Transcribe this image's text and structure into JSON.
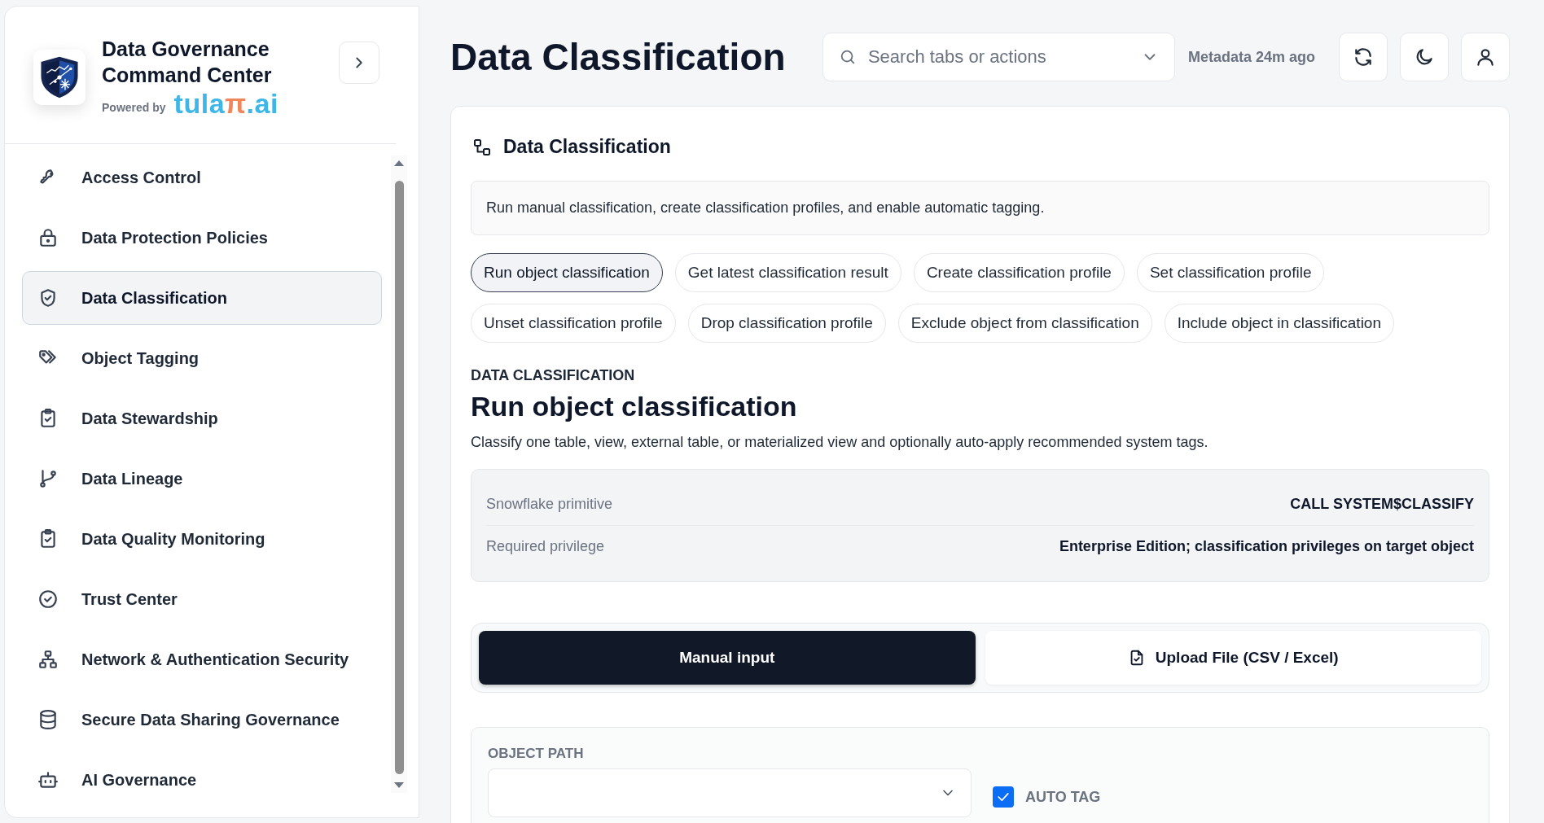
{
  "sidebar": {
    "title": "Data Governance Command Center",
    "powered_by": "Powered by",
    "brand": [
      {
        "text": "tula",
        "color": "#3fb6e8"
      },
      {
        "text": "π",
        "color": "#f0865a"
      },
      {
        "text": ".ai",
        "color": "#3fb6e8"
      }
    ],
    "nav_items": [
      {
        "label": "Access Control",
        "selected": false
      },
      {
        "label": "Data Protection Policies",
        "selected": false
      },
      {
        "label": "Data Classification",
        "selected": true
      },
      {
        "label": "Object Tagging",
        "selected": false
      },
      {
        "label": "Data Stewardship",
        "selected": false
      },
      {
        "label": "Data Lineage",
        "selected": false
      },
      {
        "label": "Data Quality Monitoring",
        "selected": false
      },
      {
        "label": "Trust Center",
        "selected": false
      },
      {
        "label": "Network & Authentication Security",
        "selected": false
      },
      {
        "label": "Secure Data Sharing Governance",
        "selected": false
      },
      {
        "label": "AI Governance",
        "selected": false
      }
    ]
  },
  "header": {
    "title": "Data Classification",
    "search": {
      "placeholder": "Search tabs or actions"
    },
    "metadata": "Metadata 24m ago"
  },
  "card": {
    "title": "Data Classification",
    "description": "Run manual classification, create classification profiles, and enable automatic tagging.",
    "actions": [
      {
        "label": "Run object classification",
        "selected": true
      },
      {
        "label": "Get latest classification result",
        "selected": false
      },
      {
        "label": "Create classification profile",
        "selected": false
      },
      {
        "label": "Set classification profile",
        "selected": false
      },
      {
        "label": "Unset classification profile",
        "selected": false
      },
      {
        "label": "Drop classification profile",
        "selected": false
      },
      {
        "label": "Exclude object from classification",
        "selected": false
      },
      {
        "label": "Include object in classification",
        "selected": false
      }
    ],
    "section_label": "DATA CLASSIFICATION",
    "heading": "Run object classification",
    "summary": "Classify one table, view, external table, or materialized view and optionally auto-apply recommended system tags.",
    "details": [
      {
        "label": "Snowflake primitive",
        "value": "CALL SYSTEM$CLASSIFY"
      },
      {
        "label": "Required privilege",
        "value": "Enterprise Edition; classification privileges on target object"
      }
    ],
    "modes": [
      {
        "label": "Manual input",
        "selected": true
      },
      {
        "label": "Upload File (CSV / Excel)",
        "selected": false
      }
    ],
    "form": {
      "field_label": "OBJECT PATH",
      "auto_tag": {
        "label": "AUTO TAG",
        "checked": true
      }
    }
  }
}
